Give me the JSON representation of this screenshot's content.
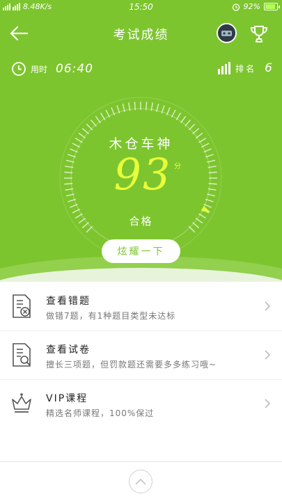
{
  "status_bar": {
    "network": "2G 4G",
    "speed": "8.48K/s",
    "time": "15:50",
    "battery": "92%",
    "battery_level": 0.92
  },
  "header": {
    "title": "考试成绩"
  },
  "info": {
    "time_label": "用时",
    "time_value": "06:40",
    "rank_label": "排名",
    "rank_value": "6"
  },
  "result": {
    "user_name": "木仓车神",
    "score": "93",
    "score_unit": "分",
    "status": "合格",
    "score_fraction": 0.93,
    "show_off_label": "炫耀一下"
  },
  "list": [
    {
      "title": "查看错题",
      "subtitle": "做错7题，有1种题目类型未达标",
      "icon": "wrong-answers-icon"
    },
    {
      "title": "查看试卷",
      "subtitle": "擅长三项题，但罚款题还需要多多练习哦~",
      "icon": "exam-paper-icon"
    },
    {
      "title": "VIP课程",
      "subtitle": "精选名师课程，100%保过",
      "icon": "crown-icon"
    }
  ],
  "colors": {
    "primary_green": "#7dc52e",
    "score_yellow": "#e8ff3a"
  }
}
